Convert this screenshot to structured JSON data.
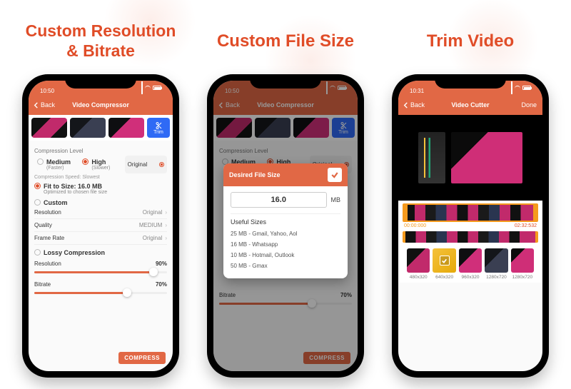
{
  "accent": "#E04C27",
  "headlines": {
    "s1_line1": "Custom Resolution",
    "s1_line2": "& Bitrate",
    "s2": "Custom File Size",
    "s3": "Trim Video"
  },
  "status": {
    "time_a": "10:50",
    "time_b": "10:50",
    "time_c": "10:31"
  },
  "nav": {
    "back": "Back",
    "title_compressor": "Video Compressor",
    "title_cutter": "Video Cutter",
    "done": "Done"
  },
  "thumbs": {
    "trim_label": "Trim"
  },
  "compression": {
    "section_label": "Compression Level",
    "medium": "Medium",
    "medium_sub": "(Faster)",
    "high": "High",
    "high_sub": "(Slower)",
    "original": "Original",
    "speed_note": "Compression Speed: Slowest",
    "fit_label": "Fit to Size: 16.0 MB",
    "fit_sub": "Optimized to chosen file size",
    "custom": "Custom",
    "rows": {
      "resolution": "Resolution",
      "resolution_val": "Original",
      "quality": "Quality",
      "quality_val": "MEDIUM",
      "framerate": "Frame Rate",
      "framerate_val": "Original"
    },
    "lossy": "Lossy Compression",
    "res_pct": "90%",
    "bitrate": "Bitrate",
    "bitrate_pct": "70%",
    "button": "COMPRESS"
  },
  "modal": {
    "title": "Desired File Size",
    "value": "16.0",
    "unit": "MB",
    "useful_title": "Useful Sizes",
    "items": [
      "25 MB - Gmail, Yahoo, Aol",
      "16 MB - Whatsapp",
      "10 MB - Hotmail, Outlook",
      "50 MB - Gmax"
    ]
  },
  "cutter": {
    "start": "00:00:000",
    "end": "02:32:532",
    "chips": [
      {
        "res": "480x320"
      },
      {
        "res": "640x320",
        "selected": true
      },
      {
        "res": "960x320"
      },
      {
        "res": "1280x720"
      },
      {
        "res": "1280x720"
      }
    ]
  }
}
